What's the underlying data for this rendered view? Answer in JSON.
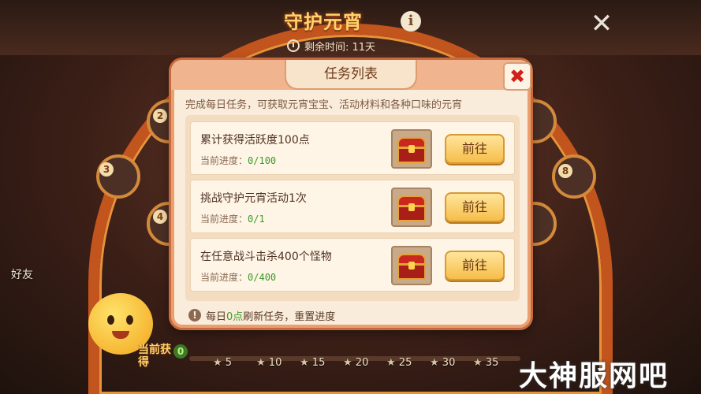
{
  "event": {
    "title": "守护元宵",
    "info_icon": "i",
    "remaining_label": "剩余时间: 11天",
    "close_icon": "✕"
  },
  "nodes": [
    "2",
    "3",
    "4",
    "8"
  ],
  "side": {
    "friends_label": "好友",
    "current_label": "当前获得",
    "current_value": "0"
  },
  "milestones": [
    "5",
    "10",
    "15",
    "20",
    "25",
    "30",
    "35"
  ],
  "watermark": "大神服网吧",
  "dialog": {
    "title": "任务列表",
    "close_icon": "✖",
    "description": "完成每日任务，可获取元宵宝宝、活动材料和各种口味的元宵",
    "progress_prefix": "当前进度：",
    "tasks": [
      {
        "name": "累计获得活跃度100点",
        "progress": "0/100",
        "button": "前往"
      },
      {
        "name": "挑战守护元宵活动1次",
        "progress": "0/1",
        "button": "前往"
      },
      {
        "name": "在任意战斗击杀400个怪物",
        "progress": "0/400",
        "button": "前往"
      }
    ],
    "footer": {
      "icon": "!",
      "prefix": "每日",
      "highlight": "0点",
      "suffix": "刷新任务，重置进度"
    }
  },
  "colors": {
    "accent_orange": "#e99f6e",
    "button_gold": "#f6be4a",
    "progress_green": "#3a9a2a",
    "close_red": "#d0211b"
  }
}
